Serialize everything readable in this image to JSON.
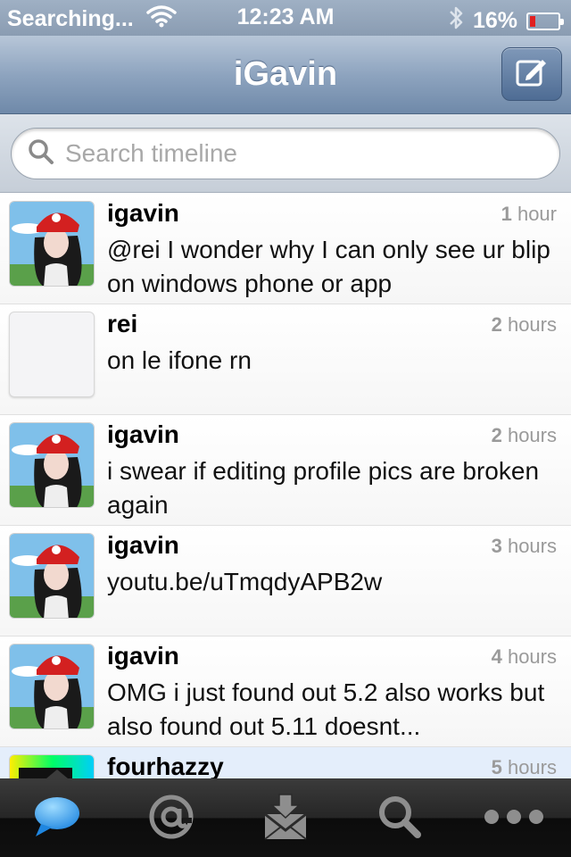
{
  "status_bar": {
    "carrier": "Searching...",
    "time": "12:23 AM",
    "battery": "16%",
    "battery_level": 0.16
  },
  "nav": {
    "title": "iGavin",
    "compose_icon": "compose-icon"
  },
  "search": {
    "placeholder": "Search timeline"
  },
  "tweets": [
    {
      "user": "igavin",
      "time_num": "1",
      "time_unit": "hour",
      "text": "@rei I wonder why I can only see ur blip on windows phone or app",
      "avatar": "photo"
    },
    {
      "user": "rei",
      "time_num": "2",
      "time_unit": "hours",
      "text": "on le ifone rn",
      "avatar": "blank"
    },
    {
      "user": "igavin",
      "time_num": "2",
      "time_unit": "hours",
      "text": "i swear if editing profile pics are broken again",
      "avatar": "photo"
    },
    {
      "user": "igavin",
      "time_num": "3",
      "time_unit": "hours",
      "text": "youtu.be/uTmqdyAPB2w",
      "avatar": "photo"
    },
    {
      "user": "igavin",
      "time_num": "4",
      "time_unit": "hours",
      "text": "OMG i just found out 5.2 also works but also found out 5.11 doesnt...",
      "avatar": "photo"
    },
    {
      "user": "fourhazzy",
      "time_num": "5",
      "time_unit": "hours",
      "text": "",
      "avatar": "color"
    }
  ],
  "tabs": [
    {
      "name": "timeline",
      "icon": "speech-bubble-icon",
      "active": true
    },
    {
      "name": "mentions",
      "icon": "at-sign-icon",
      "active": false
    },
    {
      "name": "messages",
      "icon": "inbox-envelope-icon",
      "active": false
    },
    {
      "name": "search",
      "icon": "magnifier-icon",
      "active": false
    },
    {
      "name": "more",
      "icon": "ellipsis-icon",
      "active": false
    }
  ],
  "colors": {
    "nav_gradient_top": "#b7c6d8",
    "nav_gradient_bottom": "#6f89a9",
    "active_tab": "#3aa0f0",
    "inactive_tab": "#8e8e8e"
  }
}
